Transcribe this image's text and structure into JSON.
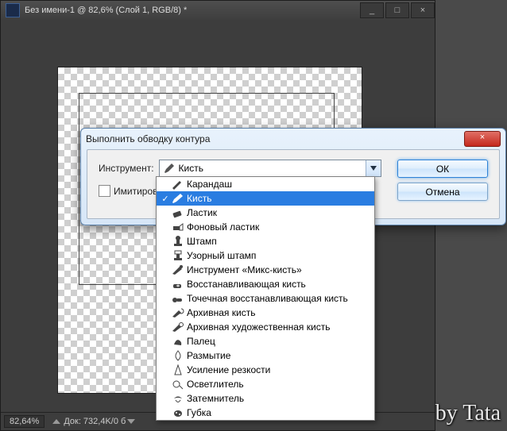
{
  "window": {
    "title": "Без имени-1 @ 82,6% (Слой 1, RGB/8) *",
    "min": "_",
    "restore": "□",
    "close": "×"
  },
  "status": {
    "zoom": "82,64%",
    "doc_info": "Док: 732,4K/0 б"
  },
  "dialog": {
    "title": "Выполнить обводку контура",
    "tool_label": "Инструмент:",
    "selected_tool": "Кисть",
    "simulate_label": "Имитироват",
    "ok": "ОК",
    "cancel": "Отмена",
    "close": "×"
  },
  "dropdown": {
    "items": [
      {
        "label": "Карандаш",
        "icon": "pencil"
      },
      {
        "label": "Кисть",
        "icon": "brush",
        "selected": true
      },
      {
        "label": "Ластик",
        "icon": "eraser"
      },
      {
        "label": "Фоновый ластик",
        "icon": "bg-eraser"
      },
      {
        "label": "Штамп",
        "icon": "stamp"
      },
      {
        "label": "Узорный штамп",
        "icon": "pattern-stamp"
      },
      {
        "label": "Инструмент «Микс-кисть»",
        "icon": "mixer-brush"
      },
      {
        "label": "Восстанавливающая кисть",
        "icon": "healing"
      },
      {
        "label": "Точечная восстанавливающая кисть",
        "icon": "spot-healing"
      },
      {
        "label": "Архивная кисть",
        "icon": "history-brush"
      },
      {
        "label": "Архивная художественная кисть",
        "icon": "art-history"
      },
      {
        "label": "Палец",
        "icon": "smudge"
      },
      {
        "label": "Размытие",
        "icon": "blur"
      },
      {
        "label": "Усиление резкости",
        "icon": "sharpen"
      },
      {
        "label": "Осветлитель",
        "icon": "dodge"
      },
      {
        "label": "Затемнитель",
        "icon": "burn"
      },
      {
        "label": "Губка",
        "icon": "sponge"
      }
    ]
  },
  "watermark": "by Tata"
}
